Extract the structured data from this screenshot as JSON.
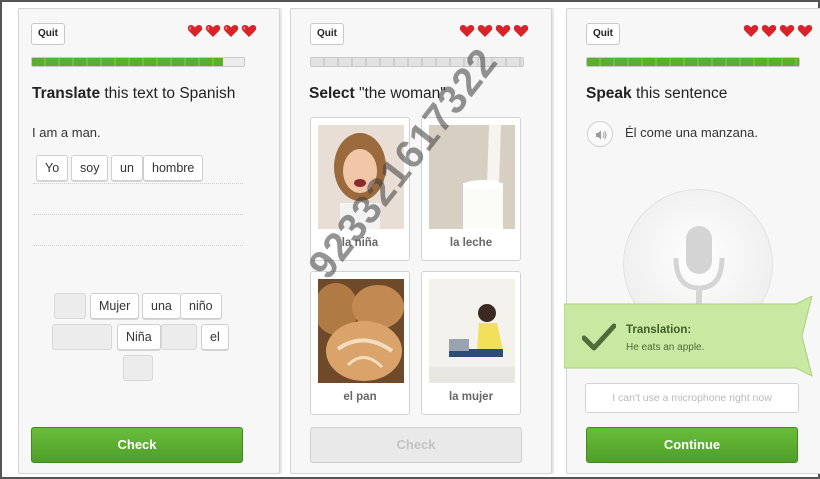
{
  "colors": {
    "accent_green": "#5cae2e",
    "heart_red": "#d8232a",
    "banner_green": "#c9e8a2"
  },
  "panel1": {
    "quit_label": "Quit",
    "hearts": 4,
    "progress": 0.9,
    "instruction_bold": "Translate",
    "instruction_rest": " this text to Spanish",
    "sentence": "I am a man.",
    "answer_chips": [
      "Yo",
      "soy",
      "un",
      "hombre"
    ],
    "bank_chips": [
      "Mujer",
      "una",
      "niño",
      "Niña",
      "el"
    ],
    "check_label": "Check"
  },
  "panel2": {
    "quit_label": "Quit",
    "hearts": 4,
    "progress": 0.0,
    "instruction_bold": "Select",
    "instruction_rest": " \"the woman\"",
    "cards": [
      {
        "label": "la niña",
        "icon": "girl-photo"
      },
      {
        "label": "la leche",
        "icon": "milk-photo"
      },
      {
        "label": "el pan",
        "icon": "bread-photo"
      },
      {
        "label": "la mujer",
        "icon": "woman-photo"
      }
    ],
    "check_label": "Check"
  },
  "panel3": {
    "quit_label": "Quit",
    "hearts": 4,
    "progress": 1.0,
    "instruction_bold": "Speak",
    "instruction_rest": " this sentence",
    "sentence": "Él come una manzana.",
    "no_mic_label": "I can't use a microphone right now",
    "banner_title": "Translation:",
    "banner_text": "He eats an apple.",
    "continue_label": "Continue"
  },
  "watermark": "923321617322"
}
